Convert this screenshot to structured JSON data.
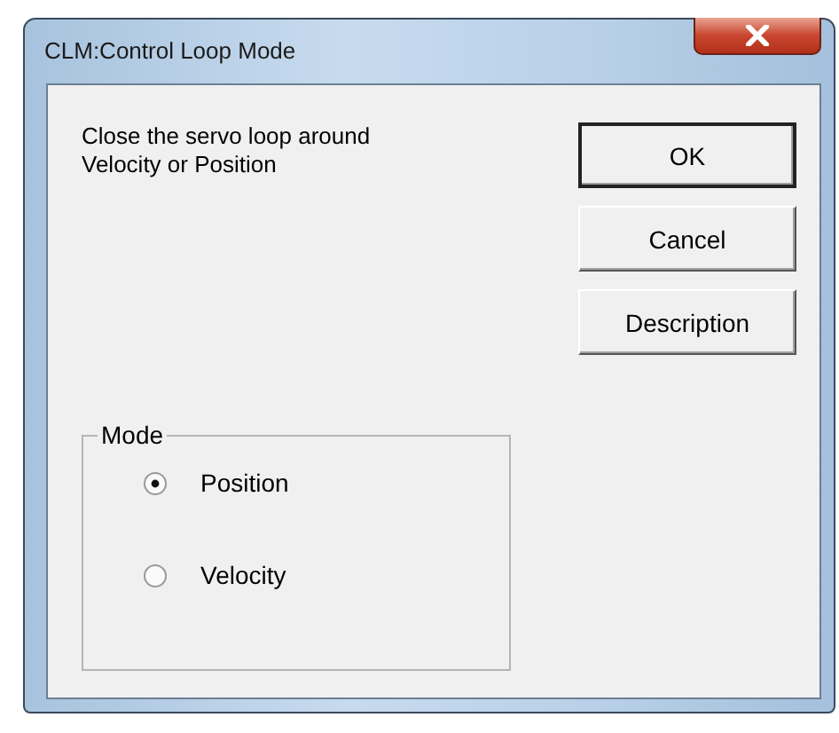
{
  "window": {
    "title": "CLM:Control Loop Mode"
  },
  "message": "Close the servo loop around Velocity or Position",
  "buttons": [
    "OK",
    "Cancel",
    "Description"
  ],
  "mode_group": {
    "label": "Mode",
    "options": [
      {
        "label": "Position",
        "selected": true
      },
      {
        "label": "Velocity",
        "selected": false
      }
    ]
  }
}
